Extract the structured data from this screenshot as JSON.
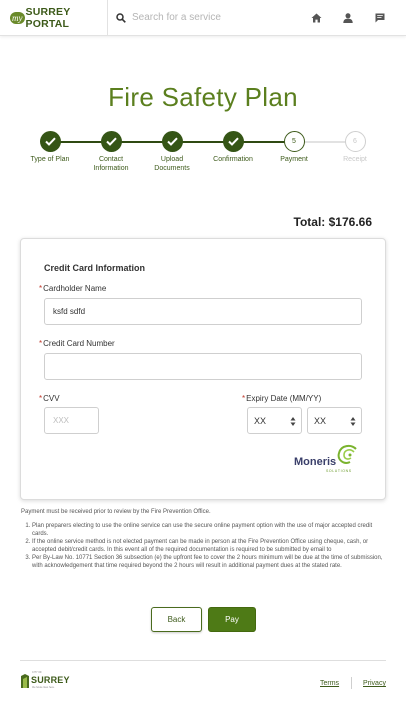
{
  "header": {
    "logo_badge": "my",
    "logo_text": "SURREY PORTAL",
    "search_placeholder": "Search for a service",
    "icons": [
      "search-icon",
      "home-icon",
      "user-icon",
      "message-icon"
    ]
  },
  "page": {
    "title": "Fire Safety Plan"
  },
  "stepper": {
    "steps": [
      {
        "label_line1": "Type of Plan",
        "label_line2": "",
        "state": "done",
        "marker": ""
      },
      {
        "label_line1": "Contact",
        "label_line2": "Information",
        "state": "done",
        "marker": ""
      },
      {
        "label_line1": "Upload",
        "label_line2": "Documents",
        "state": "done",
        "marker": ""
      },
      {
        "label_line1": "Confirmation",
        "label_line2": "",
        "state": "done",
        "marker": ""
      },
      {
        "label_line1": "Payment",
        "label_line2": "",
        "state": "current",
        "marker": "5"
      },
      {
        "label_line1": "Receipt",
        "label_line2": "",
        "state": "future",
        "marker": "6"
      }
    ]
  },
  "total": {
    "text": "Total: $176.66"
  },
  "card": {
    "title": "Credit Card Information",
    "required_mark": "*",
    "cardholder_label": "Cardholder Name",
    "cardholder_value": "ksfd sdfd",
    "card_number_label": "Credit Card Number",
    "card_number_value": "",
    "cvv_label": "CVV",
    "cvv_placeholder": "XXX",
    "expiry_label": "Expiry Date (MM/YY)",
    "expiry_month": "XX",
    "expiry_year": "XX",
    "processor_logo_text": "Moneris",
    "processor_logo_sub": "SOLUTIONS"
  },
  "notes": {
    "intro": "Payment must be received prior to review by the Fire Prevention Office.",
    "items": [
      "Plan preparers electing to use the online service can use the secure online payment option with the use of major accepted credit cards.",
      "If the online service method is not elected payment can be made in person at the Fire Prevention Office using cheque, cash, or accepted debit/credit cards. In this event all of the required documentation is required to be submitted by email to",
      "Per By-Law No. 10771 Section 36 subsection (e) the upfront fee to cover the 2 hours minimum will be due at the time of submission, with acknowledgement that time required beyond the 2 hours will result in additional payment dues at the stated rate."
    ]
  },
  "actions": {
    "back_label": "Back",
    "pay_label": "Pay"
  },
  "footer": {
    "logo_small": "CITY OF",
    "logo_text": "SURREY",
    "logo_tagline": "the future lives here.",
    "terms_label": "Terms",
    "privacy_label": "Privacy"
  },
  "colors": {
    "brand_green": "#3d5a1a",
    "title_green": "#5b7f1e",
    "pay_button": "#4e7a16"
  }
}
